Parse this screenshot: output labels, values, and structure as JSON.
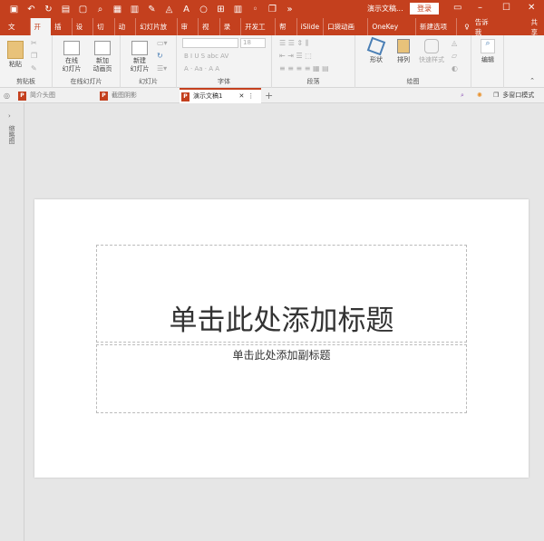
{
  "titlebar": {
    "doc_title": "演示文稿...",
    "login": "登录",
    "icons": [
      "save-icon",
      "undo-icon",
      "redo-icon",
      "present-icon",
      "new-icon",
      "preview-icon",
      "table-icon",
      "align-icon",
      "shape-icon",
      "circle-icon",
      "grid-icon",
      "more-icon"
    ]
  },
  "tabs": [
    "文件",
    "开始",
    "插入",
    "设计",
    "切换",
    "动画",
    "幻灯片放映",
    "审阅",
    "视图",
    "录制",
    "开发工具",
    "帮助",
    "iSlide",
    "口袋动画 PA",
    "OneKey Lite",
    "新建选项卡"
  ],
  "tell_me": "告诉我",
  "share": "共享",
  "ribbon": {
    "clipboard": {
      "label": "剪贴板",
      "paste": "粘贴"
    },
    "online": {
      "label": "在线幻灯片",
      "online_slide": "在线\n幻灯片",
      "new_anim": "新加\n动画页"
    },
    "slides": {
      "label": "幻灯片",
      "new_slide": "新建\n幻灯片"
    },
    "font": {
      "label": "字体",
      "size": "18",
      "row1": "B I U S abc AV",
      "row2": "A · Aa · A A"
    },
    "paragraph": {
      "label": "段落"
    },
    "drawing": {
      "label": "绘图",
      "shape": "形状",
      "arrange": "排列",
      "quick": "快速样式"
    },
    "edit": {
      "label": "编辑"
    }
  },
  "doctabs": [
    {
      "label": "简介头图"
    },
    {
      "label": "截图阴影"
    },
    {
      "label": "演示文稿1",
      "active": true
    }
  ],
  "multiwindow": "多窗口模式",
  "left_panel": "缩略图",
  "slide": {
    "title_placeholder": "单击此处添加标题",
    "subtitle_placeholder": "单击此处添加副标题"
  },
  "colors": {
    "accent": "#c4401e",
    "ribbon": "#f3f3f3",
    "workspace": "#e6e6e6"
  }
}
